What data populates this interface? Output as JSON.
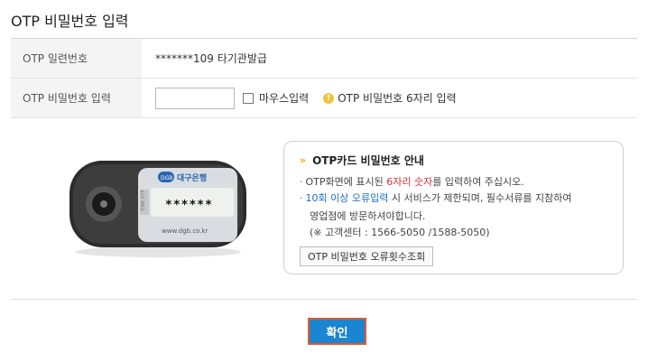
{
  "page": {
    "title": "OTP 비밀번호 입력"
  },
  "rows": {
    "serial_label": "OTP 일련번호",
    "serial_value": "*******109 타기관발급",
    "pw_label": "OTP 비밀번호 입력",
    "mouse_input_label": "마우스입력",
    "hint": "OTP 비밀번호 6자리 입력"
  },
  "info": {
    "title": "OTP카드 비밀번호 안내",
    "line1_pre": "OTP화면에 표시된 ",
    "line1_red": "6자리 숫자",
    "line1_post": "를 입력하여 주십시오.",
    "line2_blue": "10회 이상 오류입력",
    "line2_post": " 시 서비스가 제한되며, 필수서류를 지참하여",
    "line3": "영업점에 방문하셔야합니다.",
    "line4": "(※ 고객센터 : 1566-5050 /1588-5050)",
    "error_button": "OTP 비밀번호 오류횟수조회"
  },
  "token": {
    "brand": "대구은행",
    "logo": "DGB",
    "display": "******",
    "url": "www.dgb.co.kr",
    "side_text": "TIME OTP"
  },
  "actions": {
    "confirm": "확인"
  },
  "colors": {
    "accent": "#1a85d0",
    "focus_border": "#e8562a",
    "emphasis_red": "#d03030",
    "emphasis_blue": "#1c6fc2"
  }
}
